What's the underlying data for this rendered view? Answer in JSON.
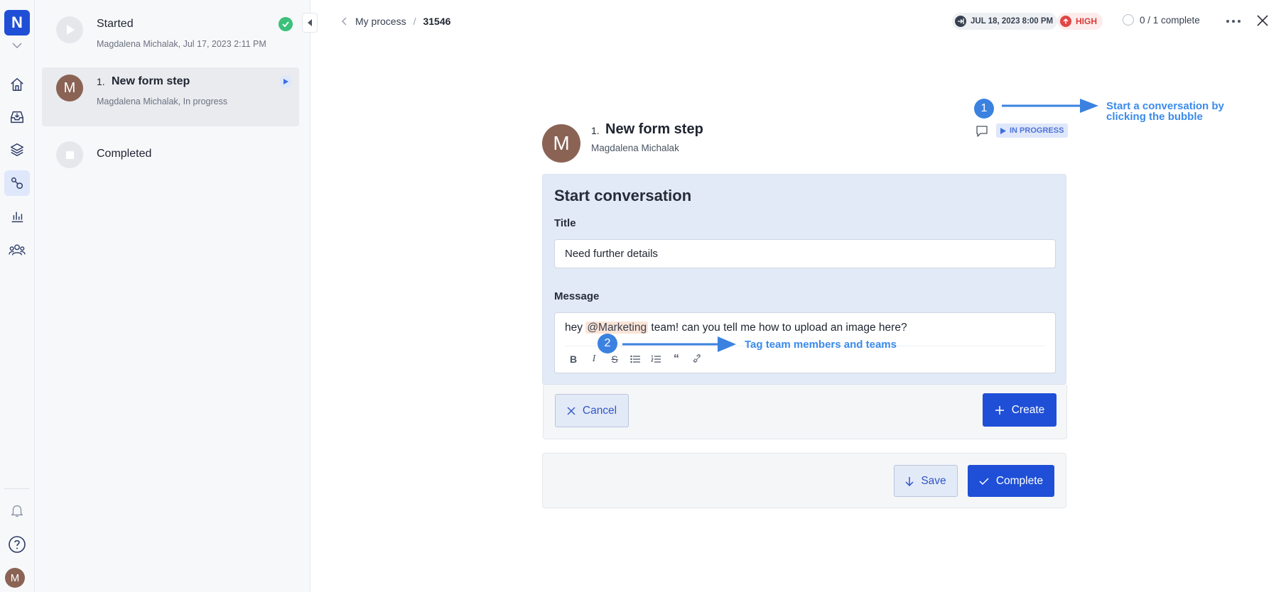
{
  "rail": {
    "logo_letter": "N",
    "items": [
      "home-icon",
      "inbox-icon",
      "layers-icon",
      "process-icon",
      "chart-icon",
      "team-icon"
    ],
    "bottom": [
      "bell-icon",
      "help-icon"
    ],
    "avatar_letter": "M"
  },
  "steps": [
    {
      "status": "done",
      "title": "Started",
      "sub": "Magdalena Michalak, Jul 17, 2023 2:11 PM"
    },
    {
      "status": "in_progress",
      "number": "1.",
      "title": "New form step",
      "sub": "Magdalena Michalak, In progress",
      "avatar_letter": "M"
    },
    {
      "status": "pending",
      "title": "Completed",
      "sub": ""
    }
  ],
  "header": {
    "breadcrumb_parent": "My process",
    "breadcrumb_sep": "/",
    "breadcrumb_id": "31546",
    "due_date": "JUL 18, 2023 8:00 PM",
    "priority": "HIGH",
    "progress": "0 / 1 complete"
  },
  "step_header": {
    "avatar_letter": "M",
    "number": "1.",
    "title": "New form step",
    "assignee": "Magdalena Michalak",
    "status": "IN PROGRESS"
  },
  "conversation": {
    "heading": "Start conversation",
    "title_label": "Title",
    "title_value": "Need further details",
    "message_label": "Message",
    "message_prefix": "hey ",
    "message_mention": "@Marketing",
    "message_suffix": " team! can you tell me how to upload an image here?",
    "cancel_label": "Cancel",
    "create_label": "Create"
  },
  "footer": {
    "save_label": "Save",
    "complete_label": "Complete"
  },
  "annotations": {
    "one_num": "1",
    "one_line1": "Start a conversation by",
    "one_line2": "clicking the bubble",
    "two_num": "2",
    "two_text": "Tag team members and teams"
  },
  "colors": {
    "primary": "#1f4fd6",
    "success": "#3cc07a",
    "priority_high": "#d93a3a",
    "annotation": "#3b8bea"
  }
}
